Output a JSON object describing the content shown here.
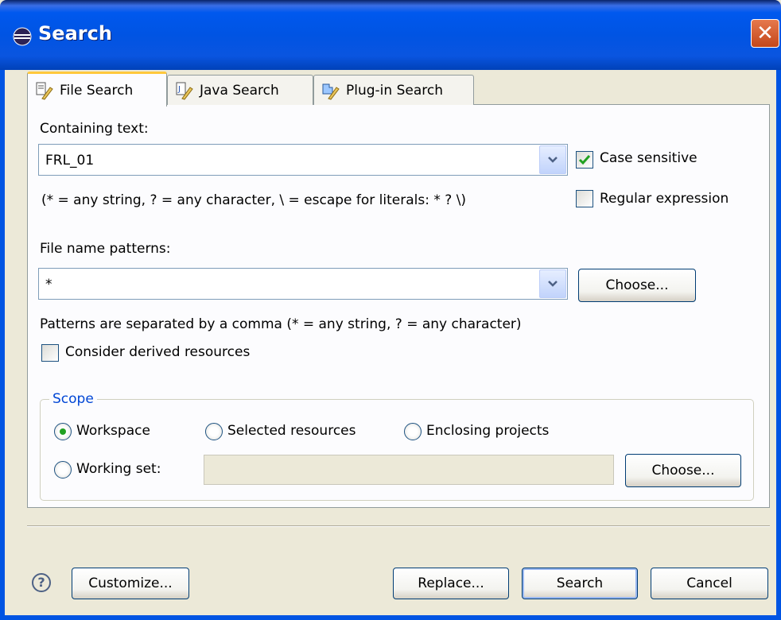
{
  "window": {
    "title": "Search",
    "close_glyph": "✕"
  },
  "tabs": [
    {
      "label": "File Search",
      "icon": "file-search-icon",
      "active": true
    },
    {
      "label": "Java Search",
      "icon": "java-search-icon",
      "active": false
    },
    {
      "label": "Plug-in Search",
      "icon": "plugin-search-icon",
      "active": false
    }
  ],
  "containing_text": {
    "label": "Containing text:",
    "value": "FRL_01",
    "hint": "(* = any string, ? = any character, \\ = escape for literals: * ? \\)"
  },
  "options": {
    "case_sensitive": {
      "label": "Case sensitive",
      "checked": true
    },
    "regular_expression": {
      "label": "Regular expression",
      "checked": false
    }
  },
  "file_name_patterns": {
    "label": "File name patterns:",
    "value": "*",
    "choose_label": "Choose...",
    "hint": "Patterns are separated by a comma (* = any string, ? = any character)"
  },
  "consider_derived": {
    "label": "Consider derived resources",
    "checked": false
  },
  "scope": {
    "legend": "Scope",
    "workspace": "Workspace",
    "selected_resources": "Selected resources",
    "enclosing_projects": "Enclosing projects",
    "working_set": "Working set:",
    "working_set_value": "",
    "choose_label": "Choose...",
    "selected": "workspace"
  },
  "footer": {
    "help_glyph": "?",
    "customize_label": "Customize...",
    "replace_label": "Replace...",
    "search_label": "Search",
    "cancel_label": "Cancel"
  },
  "colors": {
    "titlebar": "#0054e3",
    "dialog_bg": "#ece9d8",
    "panel_bg": "#fcfcfe",
    "scope_legend": "#0046d5",
    "check_green": "#21a121"
  }
}
